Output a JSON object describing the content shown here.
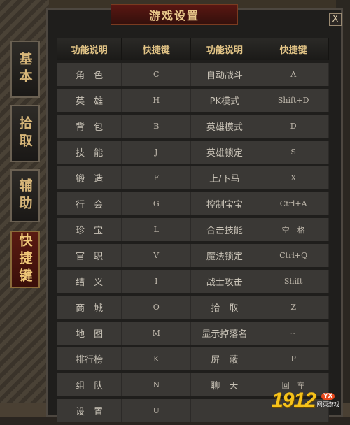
{
  "window": {
    "title": "游戏设置",
    "close_label": "X"
  },
  "side_tabs": [
    {
      "label": "基本",
      "active": false
    },
    {
      "label": "拾取",
      "active": false
    },
    {
      "label": "辅助",
      "active": false
    },
    {
      "label": "快捷键",
      "active": true
    }
  ],
  "table": {
    "headers": [
      "功能说明",
      "快捷键",
      "功能说明",
      "快捷键"
    ],
    "rows": [
      [
        "角　色",
        "C",
        "自动战斗",
        "A"
      ],
      [
        "英　雄",
        "H",
        "PK模式",
        "Shift+D"
      ],
      [
        "背　包",
        "B",
        "英雄模式",
        "D"
      ],
      [
        "技　能",
        "J",
        "英雄锁定",
        "S"
      ],
      [
        "锻　造",
        "F",
        "上/下马",
        "X"
      ],
      [
        "行　会",
        "G",
        "控制宝宝",
        "Ctrl+A"
      ],
      [
        "珍　宝",
        "L",
        "合击技能",
        "空　格"
      ],
      [
        "官　职",
        "V",
        "魔法锁定",
        "Ctrl+Q"
      ],
      [
        "结　义",
        "I",
        "战士攻击",
        "Shift"
      ],
      [
        "商　城",
        "O",
        "拾　取",
        "Z"
      ],
      [
        "地　图",
        "M",
        "显示掉落名",
        "~"
      ],
      [
        "排行榜",
        "K",
        "屏　蔽",
        "P"
      ],
      [
        "组　队",
        "N",
        "聊　天",
        "回　车"
      ],
      [
        "设　置",
        "U",
        "",
        ""
      ]
    ]
  },
  "watermark": {
    "number": "1912",
    "badge": "YX",
    "sub": "网页游戏"
  },
  "colors": {
    "title_bg": "#5a1712",
    "header_text": "#e2c486",
    "row_bg": "#3a3835"
  }
}
